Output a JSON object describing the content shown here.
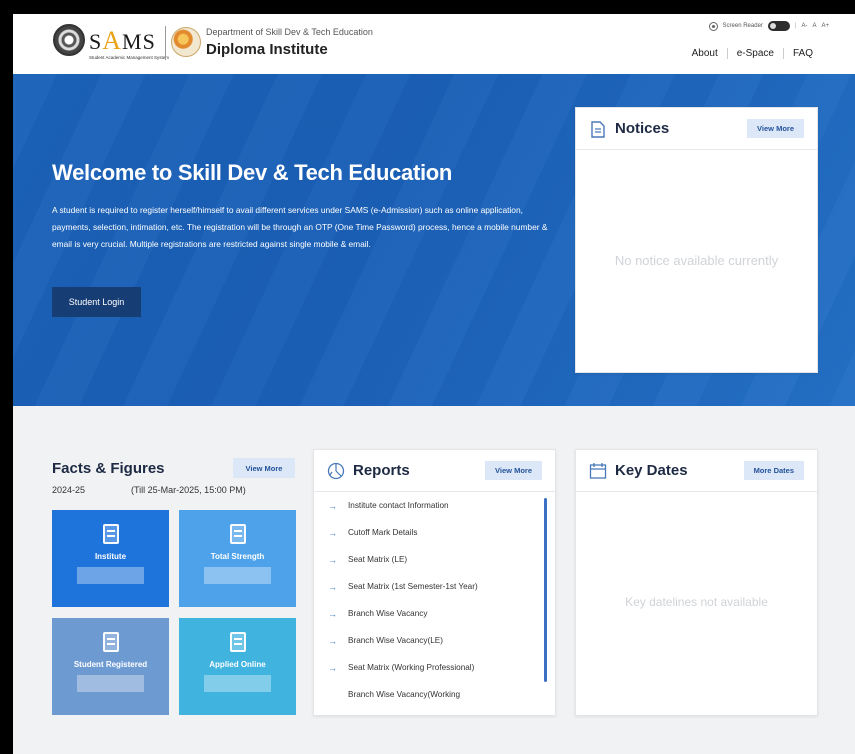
{
  "header": {
    "logo_prefix": "S",
    "logo_accent": "A",
    "logo_suffix": "MS",
    "logo_tagline": "Student Academic Management System",
    "department": "Department of Skill Dev & Tech Education",
    "institute": "Diploma Institute",
    "screen_reader_label": "Screen Reader",
    "font_small": "A-",
    "font_normal": "A",
    "font_large": "A+",
    "nav": [
      "About",
      "e-Space",
      "FAQ"
    ]
  },
  "hero": {
    "title": "Welcome to Skill Dev & Tech Education",
    "description": "A student is required to register herself/himself to avail different services under SAMS (e-Admission) such as online application, payments, selection, intimation, etc. The registration will be through an OTP (One Time Password) process, hence a mobile number & email is very crucial. Multiple registrations are restricted against single mobile & email.",
    "login_label": "Student Login"
  },
  "notices": {
    "title": "Notices",
    "view_more": "View More",
    "empty": "No notice available currently"
  },
  "facts": {
    "title": "Facts & Figures",
    "view_more": "View More",
    "year": "2024-25",
    "till": "(Till 25-Mar-2025, 15:00 PM)",
    "tiles": [
      {
        "label": "Institute"
      },
      {
        "label": "Total Strength"
      },
      {
        "label": "Student Registered"
      },
      {
        "label": "Applied Online"
      }
    ]
  },
  "reports": {
    "title": "Reports",
    "view_more": "View More",
    "items": [
      "Institute contact Information",
      "Cutoff Mark Details",
      "Seat Matrix (LE)",
      "Seat Matrix (1st Semester-1st Year)",
      "Branch Wise Vacancy",
      "Branch Wise Vacancy(LE)",
      "Seat Matrix (Working Professional)",
      "Branch Wise Vacancy(Working"
    ]
  },
  "keydates": {
    "title": "Key Dates",
    "more_dates": "More Dates",
    "empty": "Key datelines not available"
  },
  "colors": {
    "hero_blue": "#1b62b8",
    "login_button": "#163d74",
    "view_button_bg": "#dce8f7",
    "tile_institute": "#1f74dc",
    "tile_total_strength": "#4da2ea",
    "tile_student_registered": "#6e9ad2",
    "tile_applied_online": "#40b3df"
  }
}
